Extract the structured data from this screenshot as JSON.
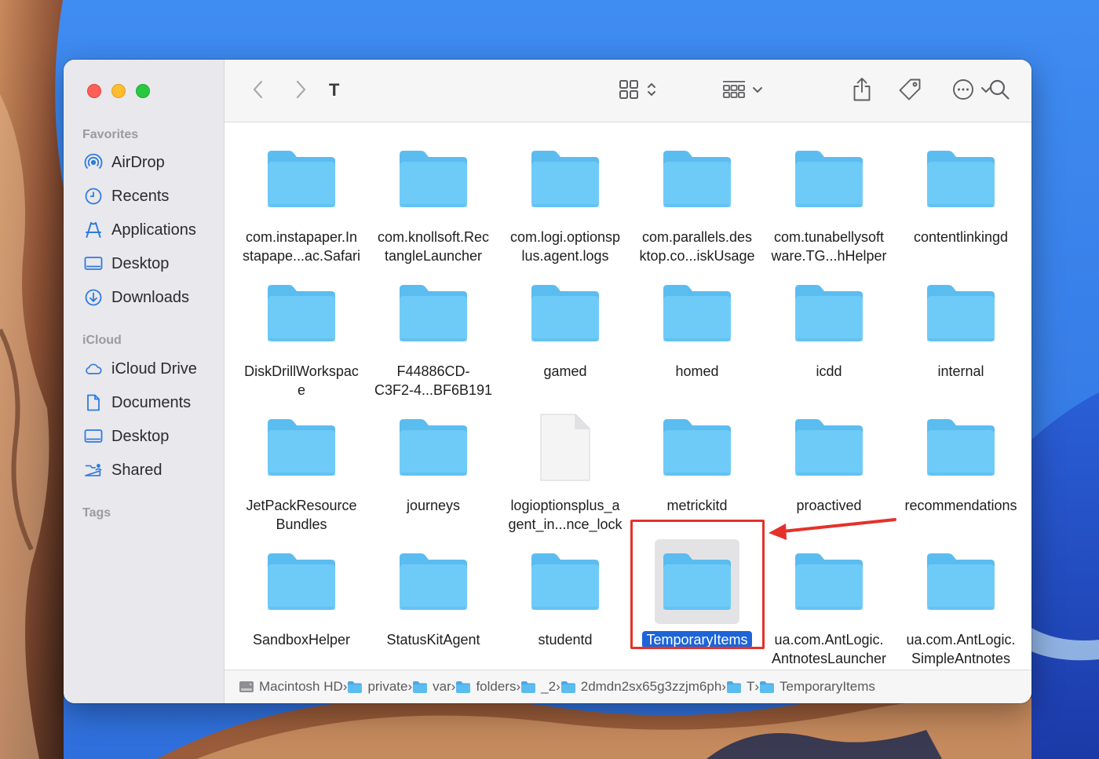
{
  "window": {
    "current_folder": "T"
  },
  "sidebar": {
    "sections": [
      {
        "title": "Favorites",
        "items": [
          {
            "label": "AirDrop",
            "icon": "airdrop-icon"
          },
          {
            "label": "Recents",
            "icon": "clock-icon"
          },
          {
            "label": "Applications",
            "icon": "applications-icon"
          },
          {
            "label": "Desktop",
            "icon": "desktop-icon"
          },
          {
            "label": "Downloads",
            "icon": "downloads-icon"
          }
        ]
      },
      {
        "title": "iCloud",
        "items": [
          {
            "label": "iCloud Drive",
            "icon": "cloud-icon"
          },
          {
            "label": "Documents",
            "icon": "document-icon"
          },
          {
            "label": "Desktop",
            "icon": "desktop-icon"
          },
          {
            "label": "Shared",
            "icon": "shared-folder-icon"
          }
        ]
      },
      {
        "title": "Tags",
        "items": []
      }
    ]
  },
  "toolbar": {
    "back_icon": "chevron-left-icon",
    "forward_icon": "chevron-right-icon",
    "view_icon": "icon-grid-view-icon",
    "group_icon": "group-by-icon",
    "share_icon": "share-icon",
    "tag_icon": "tag-icon",
    "more_icon": "ellipsis-circle-icon",
    "search_icon": "search-icon"
  },
  "files": [
    {
      "line1": "com.instapaper.In",
      "line2": "stapape...ac.Safari",
      "kind": "folder"
    },
    {
      "line1": "com.knollsoft.Rec",
      "line2": "tangleLauncher",
      "kind": "folder"
    },
    {
      "line1": "com.logi.optionsp",
      "line2": "lus.agent.logs",
      "kind": "folder"
    },
    {
      "line1": "com.parallels.des",
      "line2": "ktop.co...iskUsage",
      "kind": "folder"
    },
    {
      "line1": "com.tunabellysoft",
      "line2": "ware.TG...hHelper",
      "kind": "folder"
    },
    {
      "line1": "contentlinkingd",
      "line2": "",
      "kind": "folder"
    },
    {
      "line1": "DiskDrillWorkspac",
      "line2": "e",
      "kind": "folder"
    },
    {
      "line1": "F44886CD-",
      "line2": "C3F2-4...BF6B191",
      "kind": "folder"
    },
    {
      "line1": "gamed",
      "line2": "",
      "kind": "folder"
    },
    {
      "line1": "homed",
      "line2": "",
      "kind": "folder"
    },
    {
      "line1": "icdd",
      "line2": "",
      "kind": "folder"
    },
    {
      "line1": "internal",
      "line2": "",
      "kind": "folder"
    },
    {
      "line1": "JetPackResource",
      "line2": "Bundles",
      "kind": "folder"
    },
    {
      "line1": "journeys",
      "line2": "",
      "kind": "folder"
    },
    {
      "line1": "logioptionsplus_a",
      "line2": "gent_in...nce_lock",
      "kind": "file"
    },
    {
      "line1": "metrickitd",
      "line2": "",
      "kind": "folder"
    },
    {
      "line1": "proactived",
      "line2": "",
      "kind": "folder"
    },
    {
      "line1": "recommendations",
      "line2": "",
      "kind": "folder"
    },
    {
      "line1": "SandboxHelper",
      "line2": "",
      "kind": "folder"
    },
    {
      "line1": "StatusKitAgent",
      "line2": "",
      "kind": "folder"
    },
    {
      "line1": "studentd",
      "line2": "",
      "kind": "folder"
    },
    {
      "line1": "TemporaryItems",
      "line2": "",
      "kind": "folder",
      "selected": true
    },
    {
      "line1": "ua.com.AntLogic.",
      "line2": "AntnotesLauncher",
      "kind": "folder"
    },
    {
      "line1": "ua.com.AntLogic.",
      "line2": "SimpleAntnotes",
      "kind": "folder"
    }
  ],
  "pathbar": [
    {
      "label": "Macintosh HD",
      "icon": "hard-drive-icon"
    },
    {
      "label": "private",
      "icon": "folder-icon"
    },
    {
      "label": "var",
      "icon": "folder-icon"
    },
    {
      "label": "folders",
      "icon": "folder-icon"
    },
    {
      "label": "_2",
      "icon": "folder-icon"
    },
    {
      "label": "2dmdn2sx65g3zzjm6ph",
      "icon": "folder-icon"
    },
    {
      "label": "T",
      "icon": "folder-icon"
    },
    {
      "label": "TemporaryItems",
      "icon": "folder-icon"
    }
  ],
  "colors": {
    "folder_body": "#6ecbf7",
    "folder_tab": "#5bbcef",
    "selection": "#1d64d8",
    "annotation": "#e5312a"
  }
}
